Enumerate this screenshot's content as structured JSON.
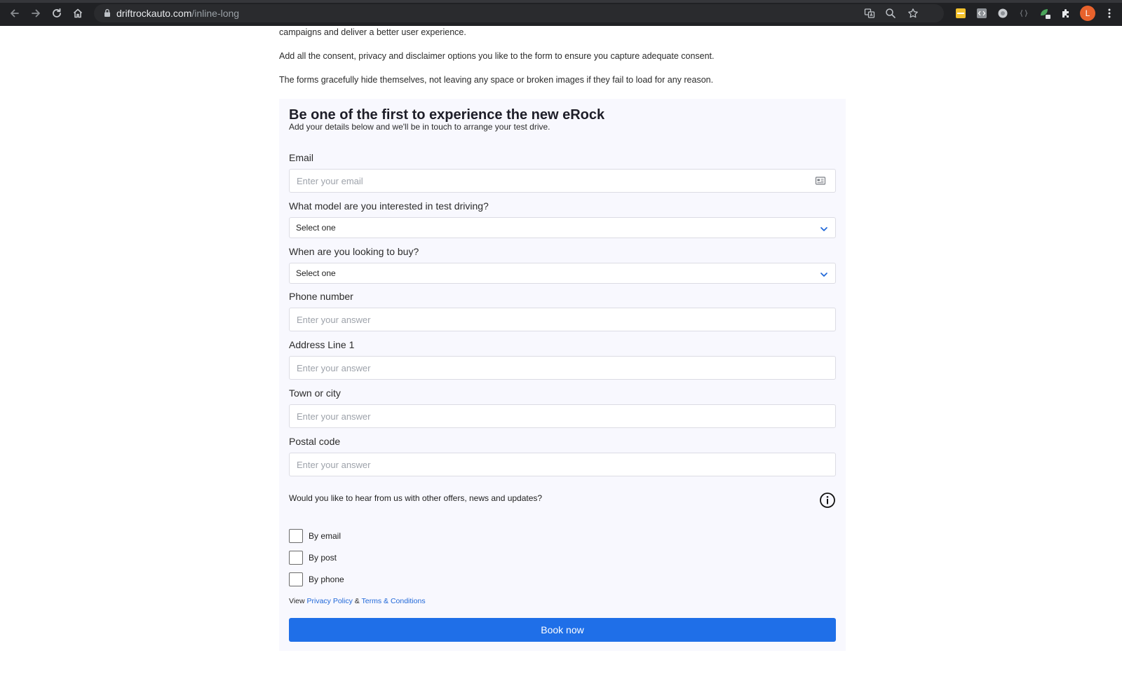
{
  "browser": {
    "url_host": "driftrockauto.com",
    "url_path": "/inline-long",
    "profile_initial": "L"
  },
  "intro": {
    "line1": "campaigns and deliver a better user experience.",
    "line2": "Add all the consent, privacy and disclaimer options you like to the form to ensure you capture adequate consent.",
    "line3": "The forms gracefully hide themselves, not leaving any space or broken images if they fail to load for any reason."
  },
  "form": {
    "title": "Be one of the first to experience the new eRock",
    "subtitle": "Add your details below and we'll be in touch to arrange your test drive.",
    "email": {
      "label": "Email",
      "placeholder": "Enter your email"
    },
    "model": {
      "label": "What model are you interested in test driving?",
      "value": "Select one"
    },
    "buy_time": {
      "label": "When are you looking to buy?",
      "value": "Select one"
    },
    "phone": {
      "label": "Phone number",
      "placeholder": "Enter your answer"
    },
    "address": {
      "label": "Address Line 1",
      "placeholder": "Enter your answer"
    },
    "town": {
      "label": "Town or city",
      "placeholder": "Enter your answer"
    },
    "postal": {
      "label": "Postal code",
      "placeholder": "Enter your answer"
    },
    "consent_question": "Would you like to hear from us with other offers, news and updates?",
    "consent_options": [
      "By email",
      "By post",
      "By phone"
    ],
    "legal": {
      "prefix": "View",
      "privacy": "Privacy Policy",
      "amp": "&",
      "terms": "Terms & Conditions"
    },
    "submit_label": "Book now"
  },
  "colors": {
    "accent": "#1f6fe8",
    "link": "#1f67d8",
    "form_bg": "#f8f8fe",
    "chrome_bg": "#202124"
  }
}
